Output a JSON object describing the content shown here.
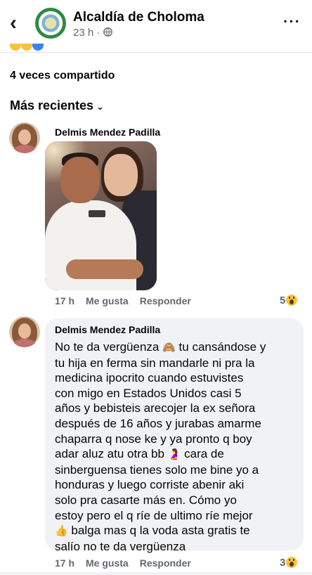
{
  "header": {
    "back_icon": "back-arrow-icon",
    "page_name": "Alcaldía de Choloma",
    "post_time": "23 h · ",
    "globe_icon": "globe-icon",
    "more_icon": "more-options-icon"
  },
  "shares_label": "4 veces compartido",
  "sort": {
    "label": "Más recientes",
    "icon": "chevron-down-icon"
  },
  "comments": [
    {
      "author": "Delmis Mendez Padilla",
      "type": "photo",
      "time": "17 h",
      "like_label": "Me gusta",
      "reply_label": "Responder",
      "reaction_count": "5",
      "reaction_icon": "wow-reaction-icon"
    },
    {
      "author": "Delmis Mendez Padilla",
      "type": "text",
      "text_lines": [
        "No te da vergüenza",
        "tu cansándose y",
        "tu hija en ferma sin mandarle ni pra la",
        "medicina ipocrito cuando estuvistes",
        "con migo en Estados Unidos casi 5",
        "años y bebisteis arecojer la ex señora",
        "después de 16 años y jurabas amarme",
        "chaparra q nose ke y ya pronto q boy",
        "adar aluz atu otra bb",
        "cara de",
        "sinberguensa tienes solo me bine yo a",
        "honduras y luego corriste abenir aki",
        "solo pra casarte más en. Cómo yo",
        "estoy pero el q ríe de ultimo ríe mejor",
        "balga mas q la voda asta gratis te",
        "salío no te da vergüenza"
      ],
      "emoji": {
        "monkey": "🙈",
        "pregnant": "🤰",
        "thumbs": "👍"
      },
      "time": "17 h",
      "like_label": "Me gusta",
      "reply_label": "Responder",
      "reaction_count": "3",
      "reaction_icon": "wow-reaction-icon"
    }
  ],
  "colors": {
    "text": "#050505",
    "secondary": "#65676b",
    "bubble": "#f0f2f5",
    "divider": "#e4e6eb"
  }
}
